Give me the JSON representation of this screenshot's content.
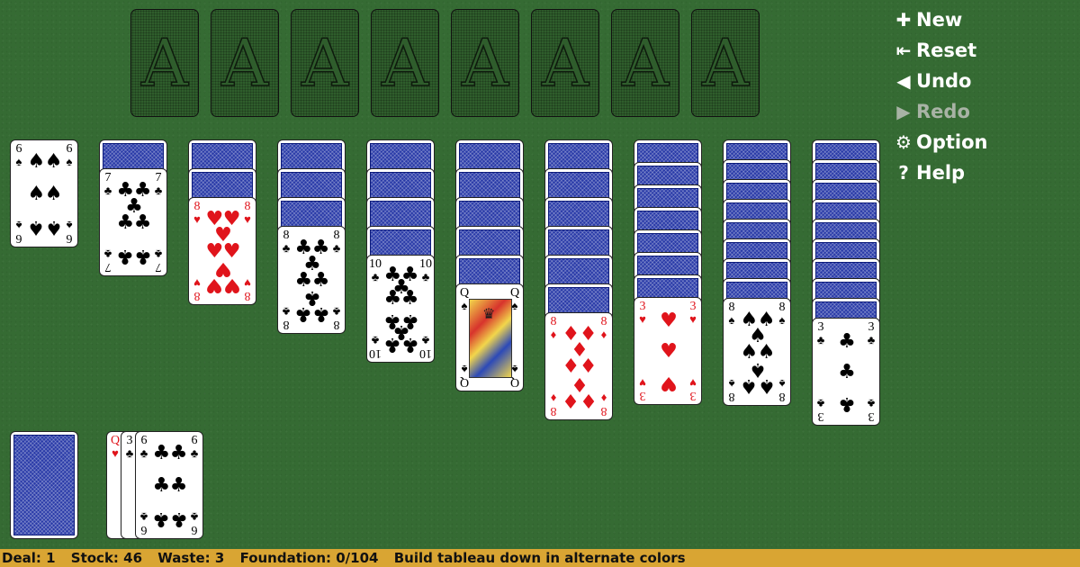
{
  "foundation_slots": [
    {
      "label": "A"
    },
    {
      "label": "A"
    },
    {
      "label": "A"
    },
    {
      "label": "A"
    },
    {
      "label": "A"
    },
    {
      "label": "A"
    },
    {
      "label": "A"
    },
    {
      "label": "A"
    }
  ],
  "tableau": [
    {
      "face_down": 0,
      "top": {
        "rank": "6",
        "suit": "♠",
        "color": "black"
      }
    },
    {
      "face_down": 1,
      "top": {
        "rank": "7",
        "suit": "♣",
        "color": "black"
      }
    },
    {
      "face_down": 2,
      "top": {
        "rank": "8",
        "suit": "♥",
        "color": "red"
      }
    },
    {
      "face_down": 3,
      "top": {
        "rank": "8",
        "suit": "♣",
        "color": "black"
      }
    },
    {
      "face_down": 4,
      "top": {
        "rank": "10",
        "suit": "♣",
        "color": "black"
      }
    },
    {
      "face_down": 5,
      "top": {
        "rank": "Q",
        "suit": "♠",
        "color": "black"
      }
    },
    {
      "face_down": 6,
      "top": {
        "rank": "8",
        "suit": "♦",
        "color": "red"
      }
    },
    {
      "face_down": 7,
      "top": {
        "rank": "3",
        "suit": "♥",
        "color": "red"
      }
    },
    {
      "face_down": 8,
      "top": {
        "rank": "8",
        "suit": "♠",
        "color": "black"
      }
    },
    {
      "face_down": 9,
      "top": {
        "rank": "3",
        "suit": "♣",
        "color": "black"
      }
    }
  ],
  "waste": [
    {
      "rank": "Q",
      "suit": "♥",
      "color": "red"
    },
    {
      "rank": "3",
      "suit": "♣",
      "color": "black"
    },
    {
      "rank": "6",
      "suit": "♣",
      "color": "black"
    }
  ],
  "menu": [
    {
      "icon": "plus-icon",
      "glyph": "✚",
      "label": "New",
      "enabled": true
    },
    {
      "icon": "reset-icon",
      "glyph": "⇤",
      "label": "Reset",
      "enabled": true
    },
    {
      "icon": "undo-icon",
      "glyph": "◀",
      "label": "Undo",
      "enabled": true
    },
    {
      "icon": "redo-icon",
      "glyph": "▶",
      "label": "Redo",
      "enabled": false
    },
    {
      "icon": "gear-icon",
      "glyph": "⚙",
      "label": "Option",
      "enabled": true
    },
    {
      "icon": "help-icon",
      "glyph": "?",
      "label": "Help",
      "enabled": true
    }
  ],
  "status": {
    "deal": "Deal: 1",
    "stock": "Stock: 46",
    "waste": "Waste: 3",
    "foundation": "Foundation: 0/104",
    "hint": "Build tableau down in alternate colors"
  },
  "colors": {
    "felt": "#356b33",
    "status_bar": "#d9a533",
    "red_suit": "#e0141b",
    "card_back": "#2a3ba8"
  }
}
